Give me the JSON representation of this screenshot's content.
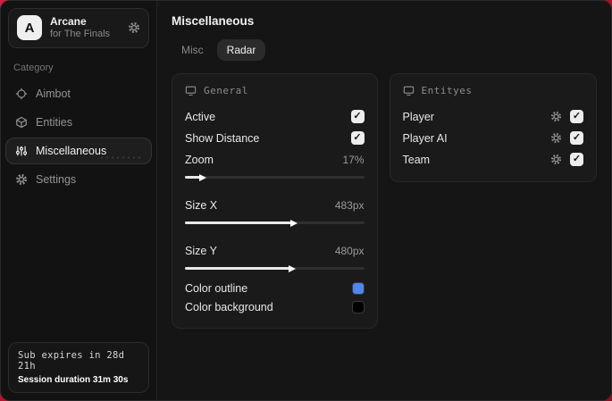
{
  "sidebar": {
    "app": {
      "initial": "A",
      "title": "Arcane",
      "subtitle": "for The Finals"
    },
    "category_label": "Category",
    "items": [
      {
        "label": "Aimbot",
        "icon": "crosshair-icon",
        "active": false
      },
      {
        "label": "Entities",
        "icon": "cube-icon",
        "active": false
      },
      {
        "label": "Miscellaneous",
        "icon": "sliders-icon",
        "active": true
      },
      {
        "label": "Settings",
        "icon": "gear-icon",
        "active": false
      }
    ],
    "footer": {
      "line1": "Sub expires in 28d 21h",
      "line2": "Session duration 31m 30s"
    }
  },
  "main": {
    "title": "Miscellaneous",
    "tabs": [
      {
        "label": "Misc",
        "active": false
      },
      {
        "label": "Radar",
        "active": true
      }
    ],
    "panels": {
      "general": {
        "title": "General",
        "toggles": [
          {
            "label": "Active",
            "checked": true
          },
          {
            "label": "Show Distance",
            "checked": true
          }
        ],
        "sliders": [
          {
            "label": "Zoom",
            "value": "17%",
            "percent": 9
          },
          {
            "label": "Size X",
            "value": "483px",
            "percent": 60
          },
          {
            "label": "Size Y",
            "value": "480px",
            "percent": 59
          }
        ],
        "colors": [
          {
            "label": "Color outline",
            "color": "#4f87f2"
          },
          {
            "label": "Color background",
            "color": "#000000"
          }
        ]
      },
      "entities": {
        "title": "Entityes",
        "rows": [
          {
            "label": "Player",
            "checked": true
          },
          {
            "label": "Player AI",
            "checked": true
          },
          {
            "label": "Team",
            "checked": true
          }
        ]
      }
    }
  }
}
